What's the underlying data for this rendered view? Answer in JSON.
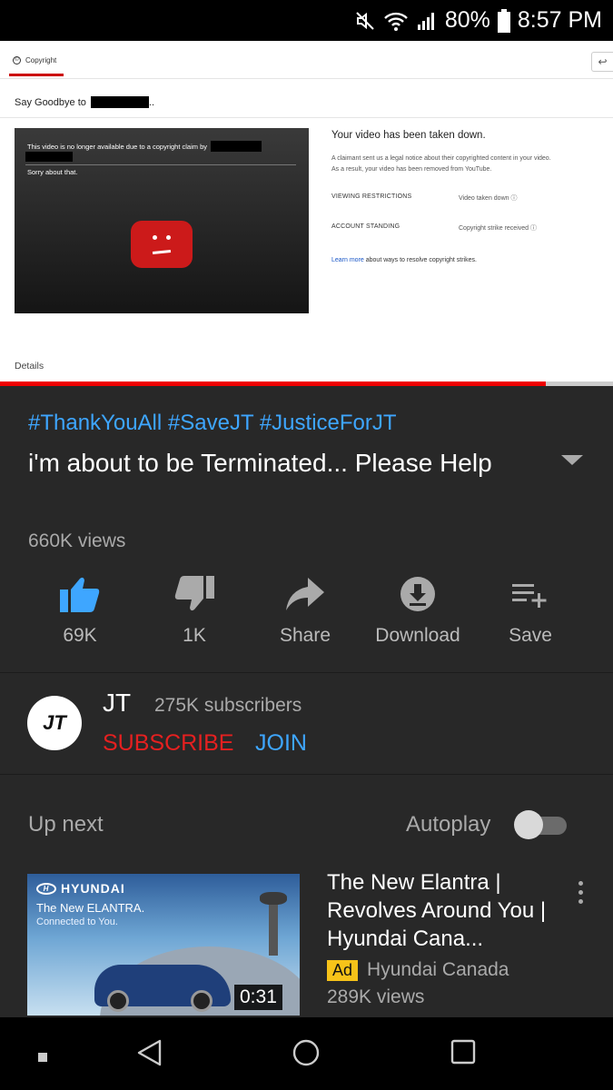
{
  "status_bar": {
    "battery": "80%",
    "time": "8:57 PM",
    "icons": [
      "mute-icon",
      "wifi-icon",
      "signal-icon",
      "battery-icon"
    ]
  },
  "video_screenshot": {
    "tab_label": "Copyright",
    "heading": "Say Goodbye to",
    "heading_suffix": "..",
    "player_message": "This video is no longer available due to a copyright claim by",
    "player_sorry": "Sorry about that.",
    "takedown_title": "Your video has been taken down.",
    "takedown_line1": "A claimant sent us a legal notice about their copyrighted content in your video.",
    "takedown_line2": "As a result, your video has been removed from YouTube.",
    "viewing_restrictions_label": "VIEWING RESTRICTIONS",
    "viewing_restrictions_value": "Video taken down",
    "account_standing_label": "ACCOUNT STANDING",
    "account_standing_value": "Copyright strike received",
    "learn_more": "Learn more",
    "learn_more_rest": "about ways to resolve copyright strikes.",
    "details": "Details",
    "progress": 0.89
  },
  "video_info": {
    "hashtags": "#ThankYouAll #SaveJT #JusticeForJT",
    "title": "i'm about to be Terminated... Please Help",
    "views": "660K views"
  },
  "actions": [
    {
      "label": "69K",
      "icon": "thumbs-up-icon"
    },
    {
      "label": "1K",
      "icon": "thumbs-down-icon"
    },
    {
      "label": "Share",
      "icon": "share-icon"
    },
    {
      "label": "Download",
      "icon": "download-icon"
    },
    {
      "label": "Save",
      "icon": "playlist-add-icon"
    }
  ],
  "channel": {
    "avatar_text": "JT",
    "name": "JT",
    "subscribers": "275K subscribers",
    "subscribe_label": "SUBSCRIBE",
    "join_label": "JOIN"
  },
  "up_next": {
    "label": "Up next",
    "autoplay_label": "Autoplay",
    "autoplay_on": false
  },
  "next_video": {
    "title": "The New Elantra | Revolves Around You | Hyundai Cana...",
    "ad_badge": "Ad",
    "channel": "Hyundai Canada",
    "views": "289K views",
    "duration": "0:31",
    "thumb_brand": "HYUNDAI",
    "thumb_tagline": "The New ELANTRA.",
    "thumb_subline": "Connected to You."
  },
  "colors": {
    "accent_blue": "#3ea6ff",
    "subscribe_red": "#e52020",
    "ad_yellow": "#f7c319",
    "like_active": "#3ea6ff"
  }
}
